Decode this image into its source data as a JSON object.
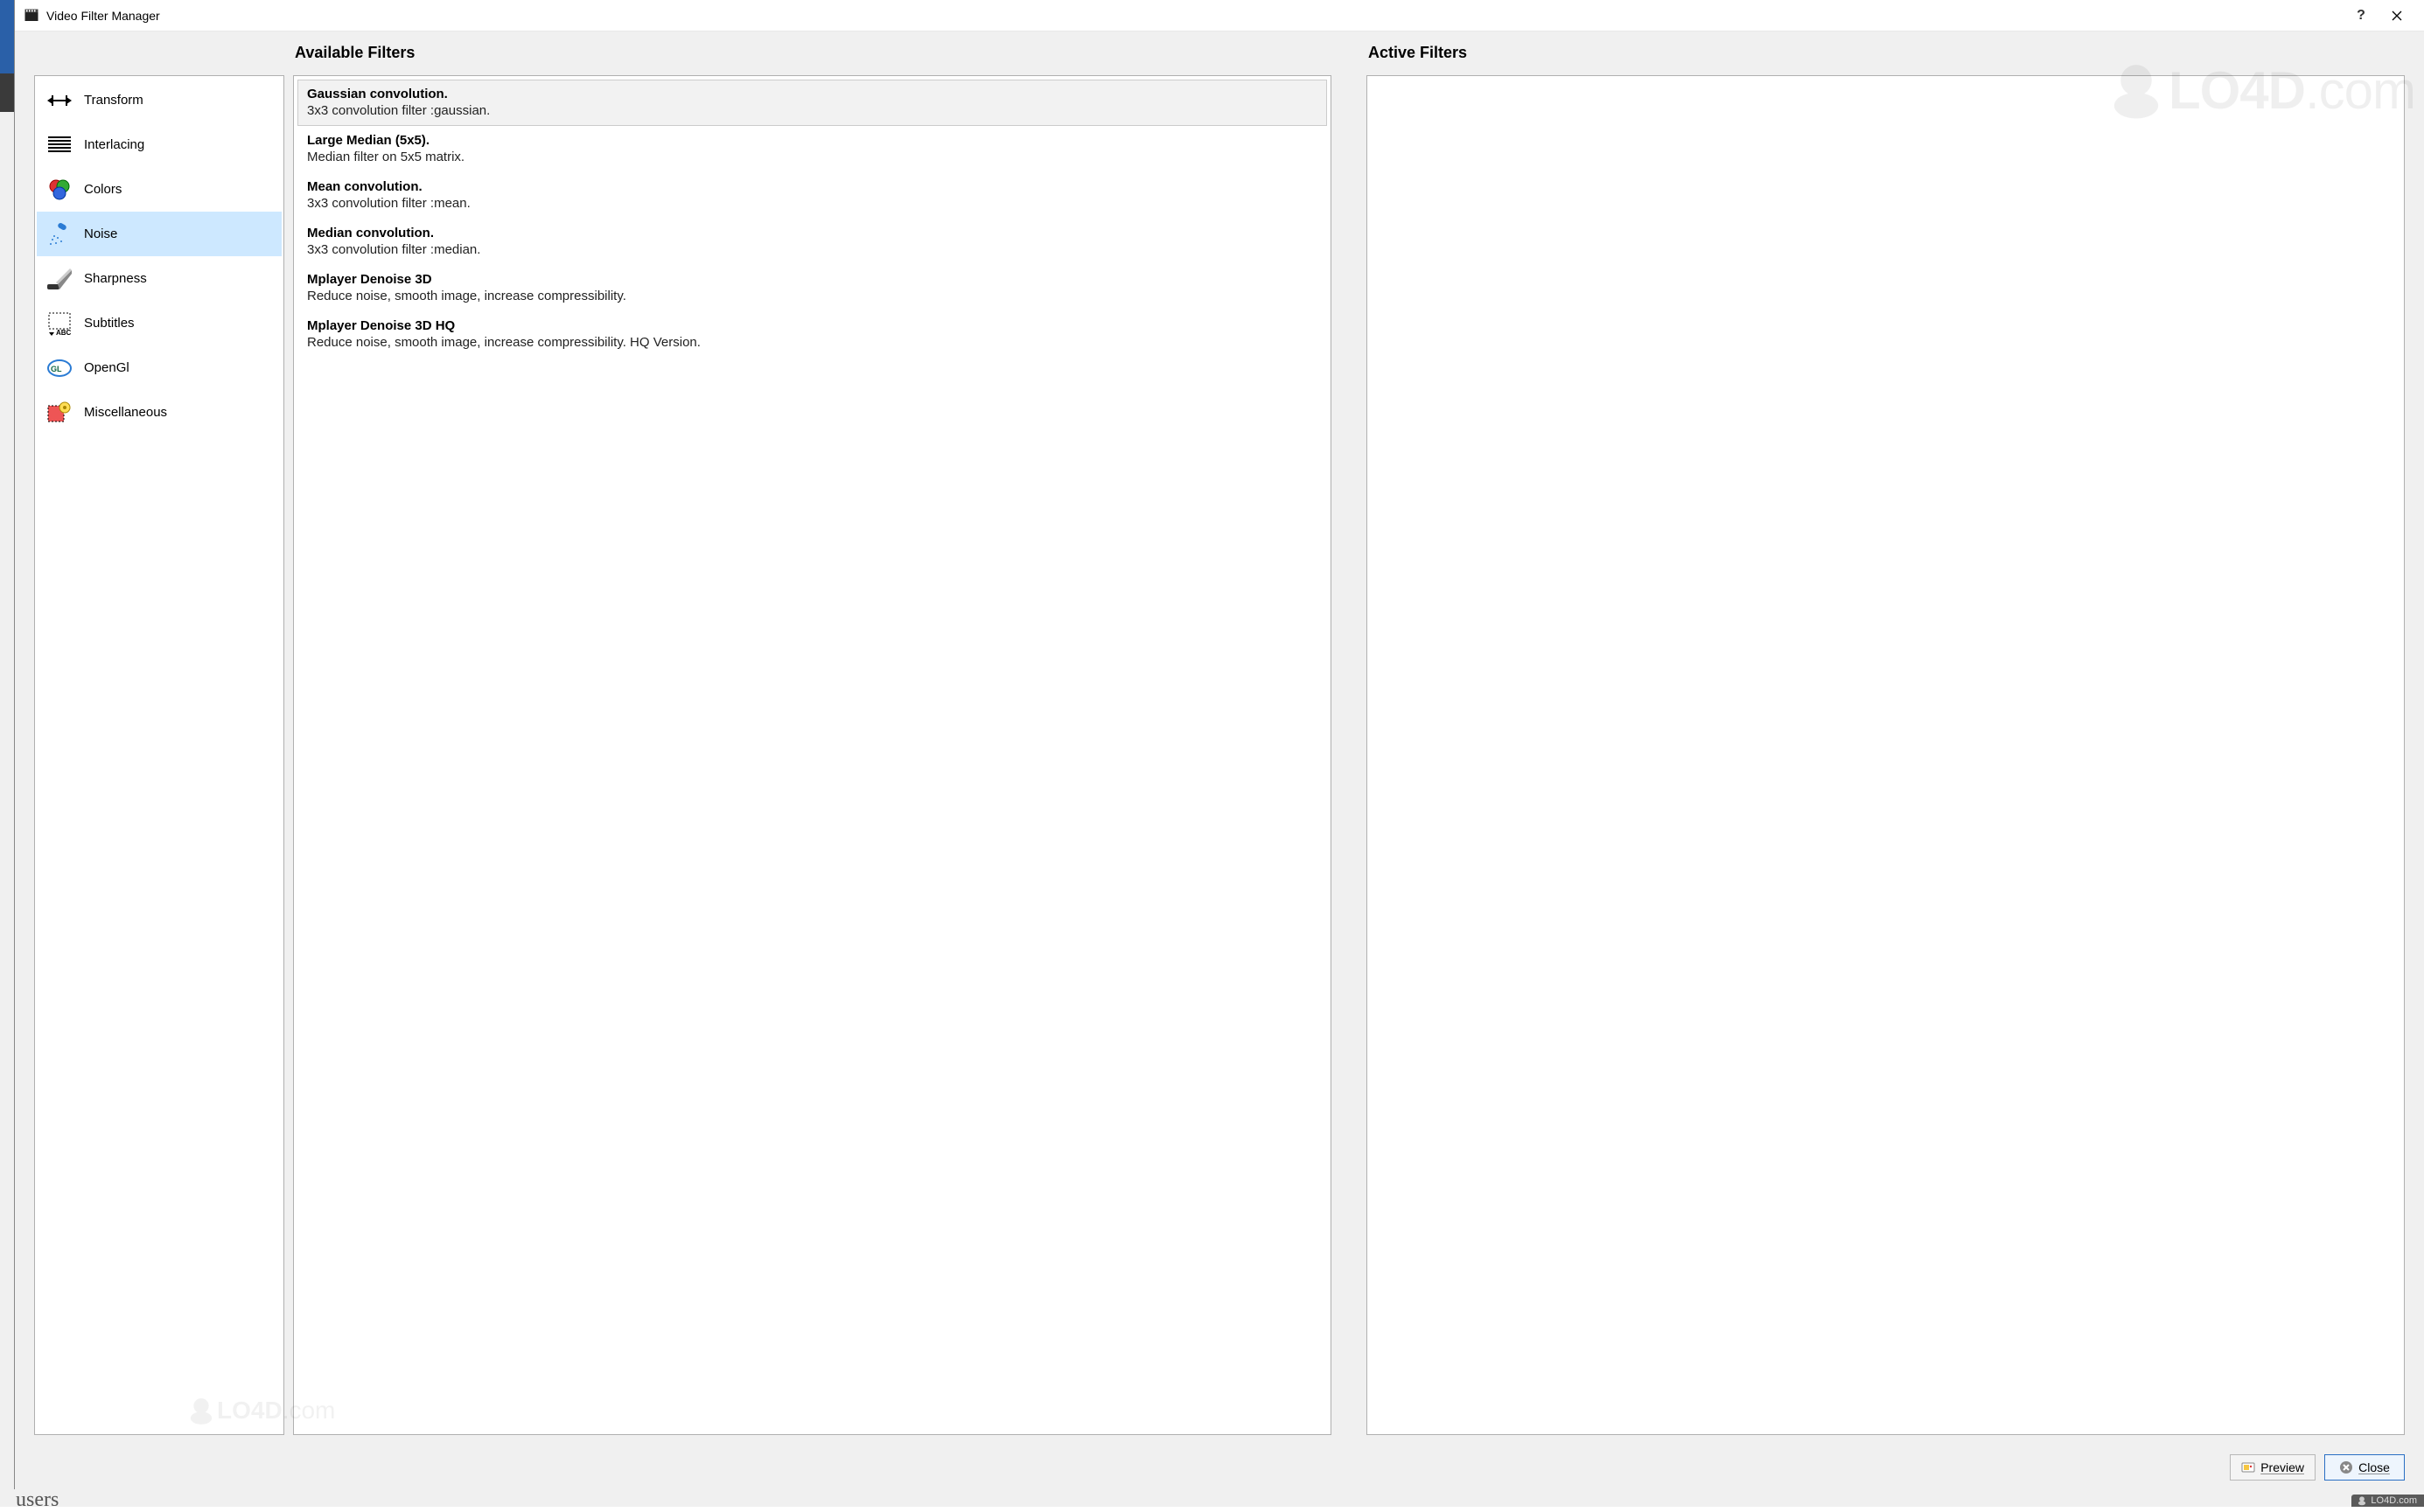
{
  "window": {
    "title": "Video Filter Manager"
  },
  "behind": {
    "users_text": "users"
  },
  "watermark_brand": "LO4D",
  "watermark_suffix": ".com",
  "footer_brand": "LO4D.com",
  "headings": {
    "available": "Available Filters",
    "active": "Active Filters"
  },
  "categories": [
    {
      "id": "transform",
      "label": "Transform",
      "selected": false
    },
    {
      "id": "interlacing",
      "label": "Interlacing",
      "selected": false
    },
    {
      "id": "colors",
      "label": "Colors",
      "selected": false
    },
    {
      "id": "noise",
      "label": "Noise",
      "selected": true
    },
    {
      "id": "sharpness",
      "label": "Sharpness",
      "selected": false
    },
    {
      "id": "subtitles",
      "label": "Subtitles",
      "selected": false
    },
    {
      "id": "opengl",
      "label": "OpenGl",
      "selected": false
    },
    {
      "id": "miscellaneous",
      "label": "Miscellaneous",
      "selected": false
    }
  ],
  "filters": [
    {
      "name": "Gaussian convolution.",
      "desc": "3x3 convolution filter :gaussian.",
      "selected": true
    },
    {
      "name": "Large Median (5x5).",
      "desc": "Median filter on 5x5 matrix.",
      "selected": false
    },
    {
      "name": "Mean convolution.",
      "desc": "3x3 convolution filter :mean.",
      "selected": false
    },
    {
      "name": "Median convolution.",
      "desc": "3x3 convolution filter :median.",
      "selected": false
    },
    {
      "name": "Mplayer Denoise 3D",
      "desc": "Reduce noise, smooth image, increase compressibility.",
      "selected": false
    },
    {
      "name": "Mplayer Denoise 3D HQ",
      "desc": "Reduce noise, smooth image, increase compressibility. HQ Version.",
      "selected": false
    }
  ],
  "active_filters": [],
  "buttons": {
    "preview": "Preview",
    "close": "Close"
  }
}
